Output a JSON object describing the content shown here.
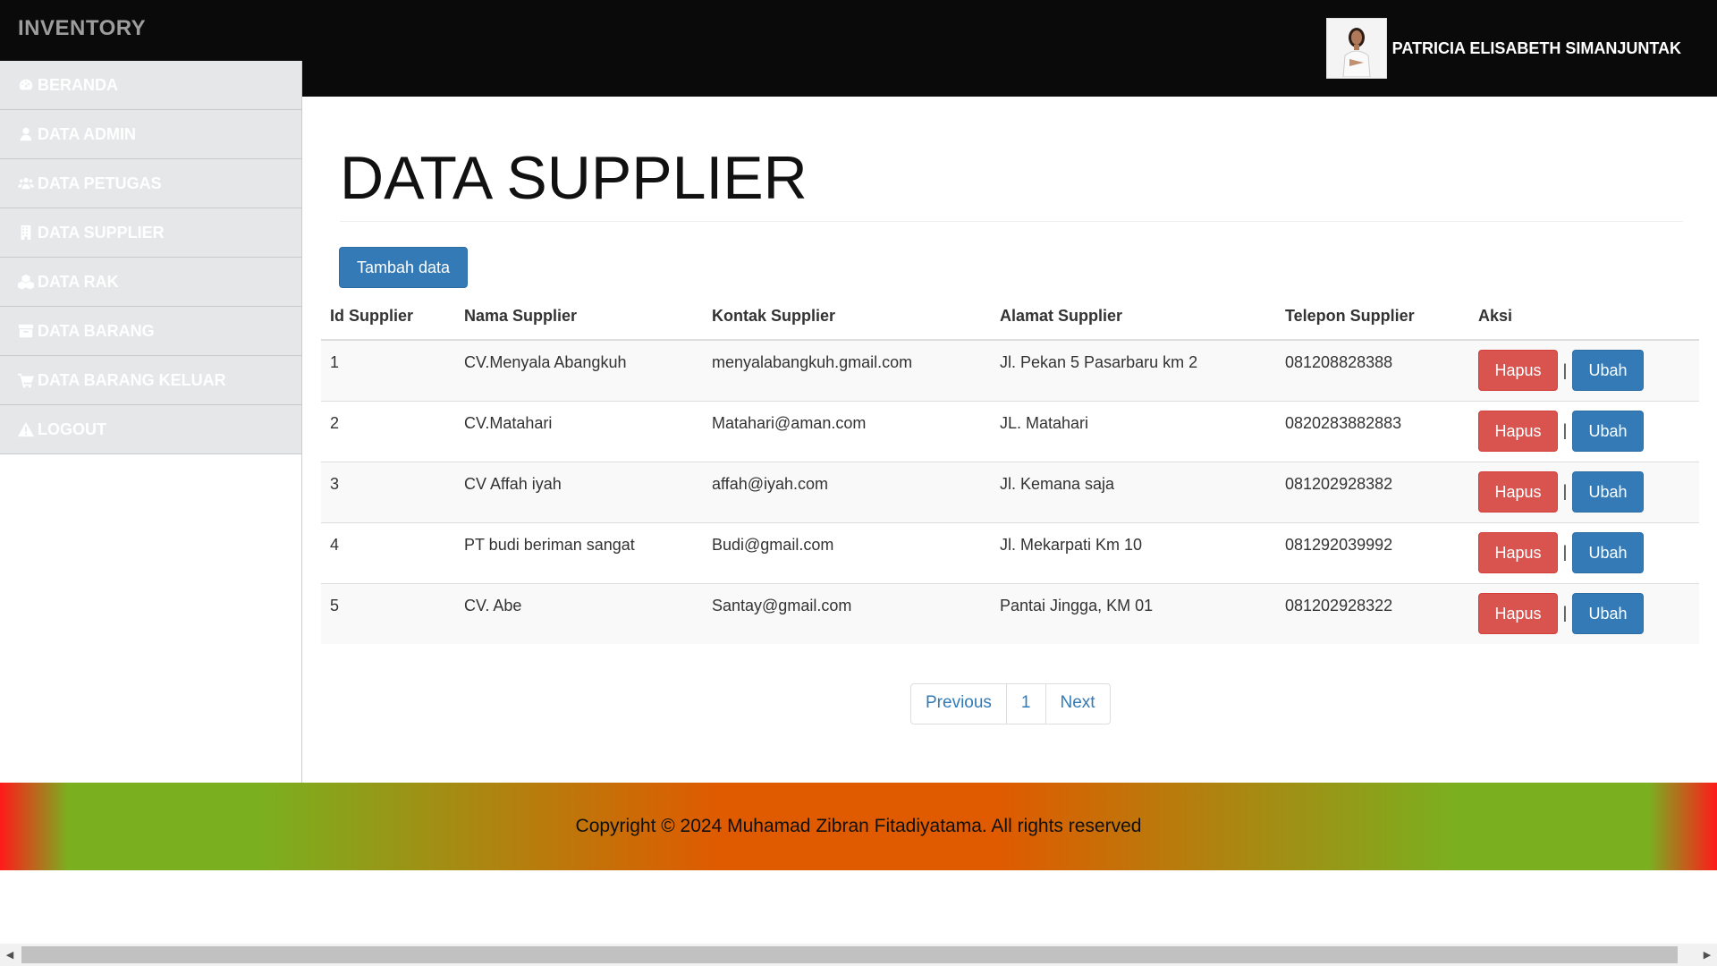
{
  "app": {
    "brand": "INVENTORY",
    "user_name": "PATRICIA ELISABETH SIMANJUNTAK"
  },
  "sidebar": {
    "items": [
      {
        "label": "BERANDA",
        "icon": "dashboard-icon"
      },
      {
        "label": "DATA ADMIN",
        "icon": "user-icon"
      },
      {
        "label": "DATA PETUGAS",
        "icon": "users-icon"
      },
      {
        "label": "DATA SUPPLIER",
        "icon": "building-icon"
      },
      {
        "label": "DATA RAK",
        "icon": "cubes-icon"
      },
      {
        "label": "DATA BARANG",
        "icon": "archive-icon"
      },
      {
        "label": "DATA BARANG KELUAR",
        "icon": "cart-icon"
      },
      {
        "label": "LOGOUT",
        "icon": "warning-icon"
      }
    ]
  },
  "main": {
    "title": "DATA SUPPLIER",
    "add_button": "Tambah data",
    "table": {
      "headers": [
        "Id Supplier",
        "Nama Supplier",
        "Kontak Supplier",
        "Alamat Supplier",
        "Telepon Supplier",
        "Aksi"
      ],
      "rows": [
        [
          "1",
          "CV.Menyala Abangkuh",
          "menyalabangkuh.gmail.com",
          "Jl. Pekan 5 Pasarbaru km 2",
          "081208828388"
        ],
        [
          "2",
          "CV.Matahari",
          "Matahari@aman.com",
          "JL. Matahari",
          "0820283882883"
        ],
        [
          "3",
          "CV Affah iyah",
          "affah@iyah.com",
          "Jl. Kemana saja",
          "081202928382"
        ],
        [
          "4",
          "PT budi beriman sangat",
          "Budi@gmail.com",
          "Jl. Mekarpati Km 10",
          "081292039992"
        ],
        [
          "5",
          "CV. Abe",
          "Santay@gmail.com",
          "Pantai Jingga, KM 01",
          "081202928322"
        ]
      ],
      "delete_label": "Hapus",
      "edit_label": "Ubah",
      "separator": "|"
    },
    "pagination": {
      "previous": "Previous",
      "current": "1",
      "next": "Next"
    }
  },
  "footer": {
    "text": "Copyright © 2024 Muhamad Zibran Fitadiyatama. All rights reserved"
  },
  "colors": {
    "topbar": "#0a0a0a",
    "primary": "#337ab7",
    "danger": "#d9534f",
    "sidebar_item": "#e6e7e8"
  }
}
